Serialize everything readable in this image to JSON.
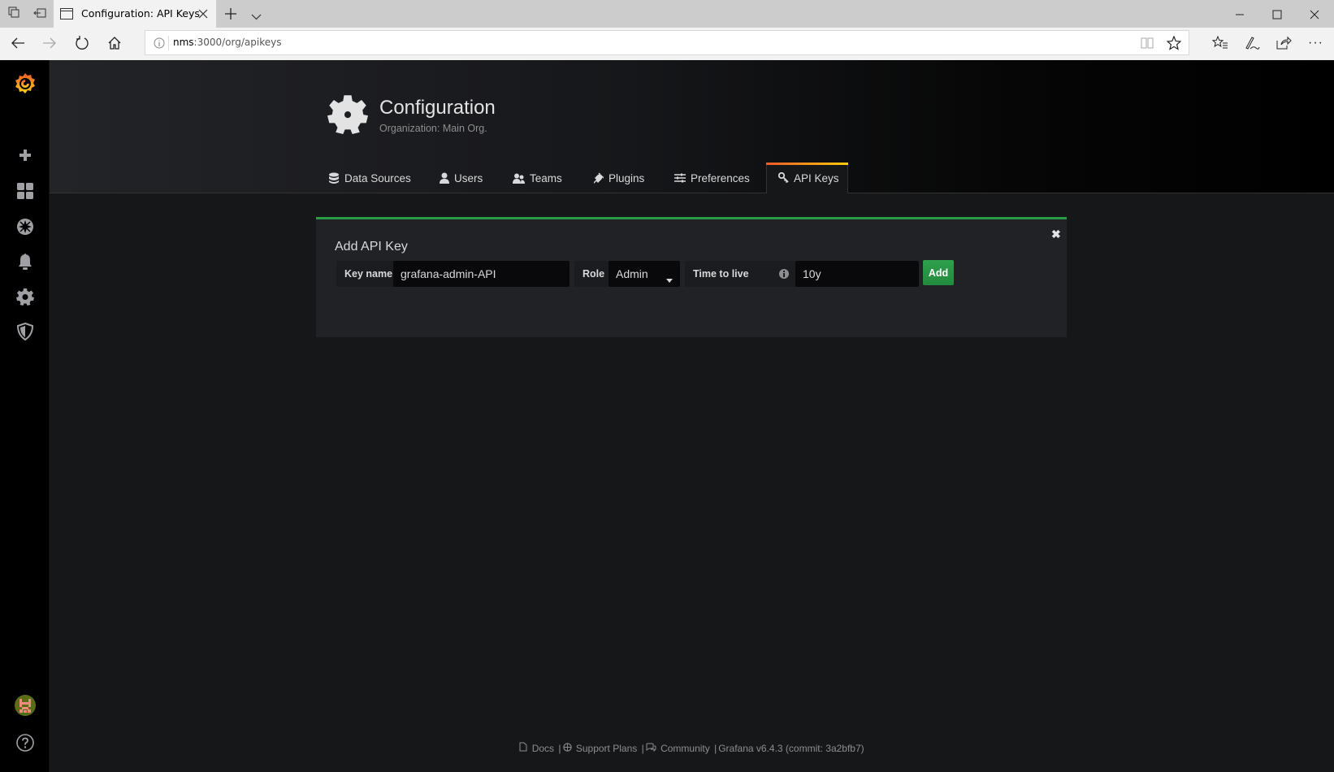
{
  "browser": {
    "tab_title": "Configuration: API Keys",
    "url_host": "nms",
    "url_rest": ":3000/org/apikeys",
    "icons": [
      "tab-actions-icon",
      "set-aside-icon",
      "page-icon",
      "close-tab-icon",
      "new-tab-icon",
      "tab-list-chevron-icon",
      "minimize-icon",
      "maximize-icon",
      "window-close-icon",
      "back-icon",
      "forward-icon",
      "refresh-icon",
      "home-icon",
      "site-info-icon",
      "reading-view-icon",
      "favorite-star-icon",
      "favorites-list-icon",
      "pen-icon",
      "share-icon",
      "more-icon"
    ]
  },
  "sidebar": {
    "items": [
      {
        "name": "grafana-logo",
        "icon": "grafana-logo-icon"
      },
      {
        "name": "create",
        "icon": "plus-icon"
      },
      {
        "name": "dashboards",
        "icon": "dashboard-grid-icon"
      },
      {
        "name": "explore",
        "icon": "compass-icon"
      },
      {
        "name": "alerting",
        "icon": "bell-icon"
      },
      {
        "name": "configuration",
        "icon": "gear-icon"
      },
      {
        "name": "server-admin",
        "icon": "shield-icon"
      },
      {
        "name": "profile",
        "icon": "avatar-icon"
      },
      {
        "name": "help",
        "icon": "help-icon"
      }
    ]
  },
  "header": {
    "title": "Configuration",
    "subtitle": "Organization: Main Org.",
    "tabs": [
      {
        "label": "Data Sources",
        "icon": "database-icon",
        "active": false
      },
      {
        "label": "Users",
        "icon": "user-icon",
        "active": false
      },
      {
        "label": "Teams",
        "icon": "users-icon",
        "active": false
      },
      {
        "label": "Plugins",
        "icon": "plug-icon",
        "active": false
      },
      {
        "label": "Preferences",
        "icon": "sliders-icon",
        "active": false
      },
      {
        "label": "API Keys",
        "icon": "key-icon",
        "active": true
      }
    ]
  },
  "form": {
    "title": "Add API Key",
    "key_name_label": "Key name",
    "key_name_value": "grafana-admin-API",
    "role_label": "Role",
    "role_value": "Admin",
    "ttl_label": "Time to live",
    "ttl_value": "10y",
    "add_label": "Add",
    "close_glyph": "✖"
  },
  "footer": {
    "docs": "Docs",
    "support": "Support Plans",
    "community": "Community",
    "version": "Grafana v6.4.3 (commit: 3a2bfb7)",
    "sep": "|"
  },
  "colors": {
    "accent_green": "#299c46",
    "tab_gradient_start": "#f05a28",
    "tab_gradient_end": "#fbca0a",
    "page_bg": "#161719"
  }
}
